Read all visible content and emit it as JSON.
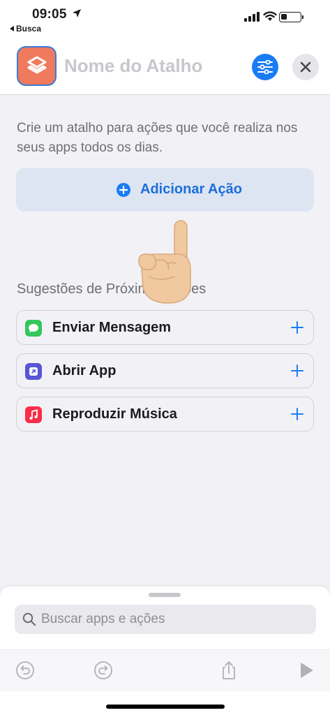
{
  "status_bar": {
    "time": "09:05",
    "back_app": "Busca",
    "battery_level": 0.3
  },
  "header": {
    "shortcut_name_placeholder": "Nome do Atalho",
    "icon_color": "#f07a5e",
    "accent_color": "#1a7cf5"
  },
  "main": {
    "intro_text": "Crie um atalho para ações que você realiza nos seus apps todos os dias.",
    "add_action_label": "Adicionar Ação",
    "suggestions_title": "Sugestões de Próximas Ações",
    "suggestions": [
      {
        "label": "Enviar Mensagem",
        "icon": "messages-icon",
        "icon_color": "#34c759"
      },
      {
        "label": "Abrir App",
        "icon": "open-app-icon",
        "icon_color": "#5856d6"
      },
      {
        "label": "Reproduzir Música",
        "icon": "music-icon",
        "icon_color": "#fa2d48"
      }
    ]
  },
  "bottom_sheet": {
    "search_placeholder": "Buscar apps e ações",
    "toolbar": [
      "undo-icon",
      "redo-icon",
      "share-icon",
      "play-icon"
    ]
  }
}
